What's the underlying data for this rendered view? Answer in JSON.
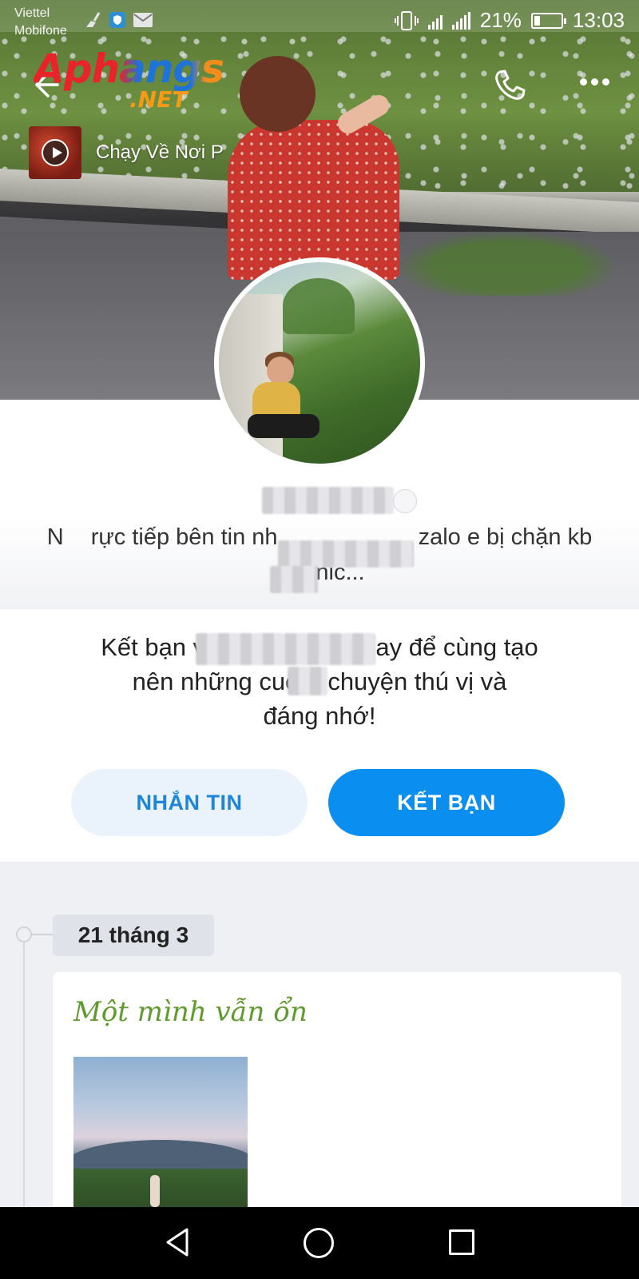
{
  "status_bar": {
    "carrier_1": "Viettel",
    "carrier_2": "Mobifone",
    "battery_percent": "21%",
    "battery_level": 0.21,
    "time": "13:03"
  },
  "header": {
    "logo_text": "Aphangs",
    "logo_suffix": ".NET"
  },
  "music": {
    "song_title": "Chạy Về Nơi P"
  },
  "profile": {
    "bio_part_1": "N",
    "bio_part_2": "rực tiếp bên tin nh",
    "bio_part_3": "zalo e bị chặn kb",
    "bio_part_4": "...",
    "bio_tail": "nic..."
  },
  "friend_prompt": {
    "line_1a": "Kết bạn v",
    "line_1b": "gay để cùng tạo",
    "line_2a": "nên những cuộ",
    "line_2b": "chuyện thú vị và",
    "line_3": "đáng nhớ!"
  },
  "buttons": {
    "message_label": "NHẮN TIN",
    "add_friend_label": "KẾT BẠN"
  },
  "timeline": {
    "date_label": "21 tháng 3",
    "post_title": "Một mình vẫn ổn"
  },
  "colors": {
    "accent": "#0a8ff0",
    "message_button_bg": "#eaf3fb",
    "message_button_text": "#1d86d8",
    "post_title": "#5e9a2c",
    "timeline_bg": "#eef0f4"
  },
  "icons": {
    "back": "back-arrow-icon",
    "call": "phone-icon",
    "more": "more-dots-icon",
    "play": "play-icon",
    "nav_back": "triangle-back-icon",
    "nav_home": "circle-home-icon",
    "nav_recent": "square-recent-icon"
  }
}
